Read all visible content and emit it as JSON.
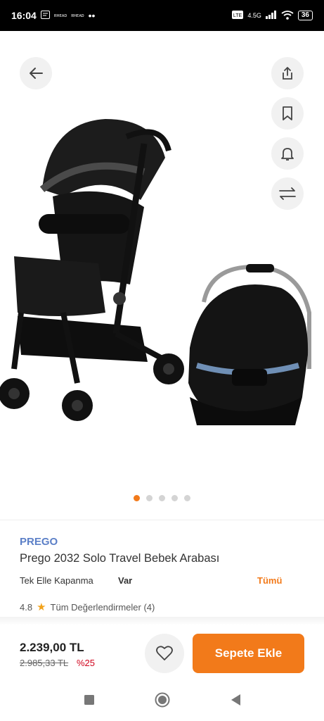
{
  "status_bar": {
    "time": "16:04",
    "left_mini_a": "ʀʜᴇᴀᴅ",
    "left_mini_b": "ʀʜᴇᴀᴅ",
    "more": "••",
    "network": "4.5G",
    "battery": "36"
  },
  "product": {
    "brand": "PREGO",
    "title": "Prego 2032 Solo Travel Bebek Arabası",
    "attribute_name": "Tek Elle Kapanma",
    "attribute_value": "Var",
    "attribute_all_link": "Tümü",
    "rating_value": "4.8",
    "reviews_link": "Tüm Değerlendirmeler (4)"
  },
  "gallery": {
    "image_count": 5,
    "active_index": 0
  },
  "purchase": {
    "price": "2.239,00 TL",
    "old_price": "2.985,33 TL",
    "discount": "%25",
    "add_to_cart_label": "Sepete Ekle"
  },
  "colors": {
    "accent": "#f27a1a",
    "brand_link": "#5b7fc7",
    "discount": "#d0021b"
  },
  "icons": [
    "back-arrow-icon",
    "share-icon",
    "bookmark-icon",
    "bell-icon",
    "compare-icon",
    "heart-icon",
    "star-icon",
    "nav-square-icon",
    "nav-home-icon",
    "nav-back-icon"
  ]
}
